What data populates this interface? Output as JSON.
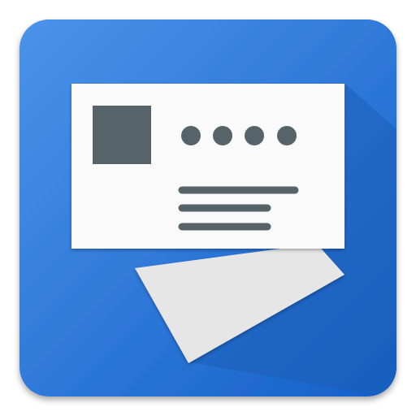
{
  "app_icon": {
    "icon_name": "business-card-icon",
    "colors": {
      "tile_top": "#3F8FE8",
      "tile_bottom": "#1763CB",
      "long_shadow": "#1B5EB8",
      "card_front": "#FAFAFA",
      "card_back": "#E6E6E6",
      "glyph": "#566369"
    },
    "card": {
      "dots_count": 4,
      "text_lines_count": 3
    }
  }
}
